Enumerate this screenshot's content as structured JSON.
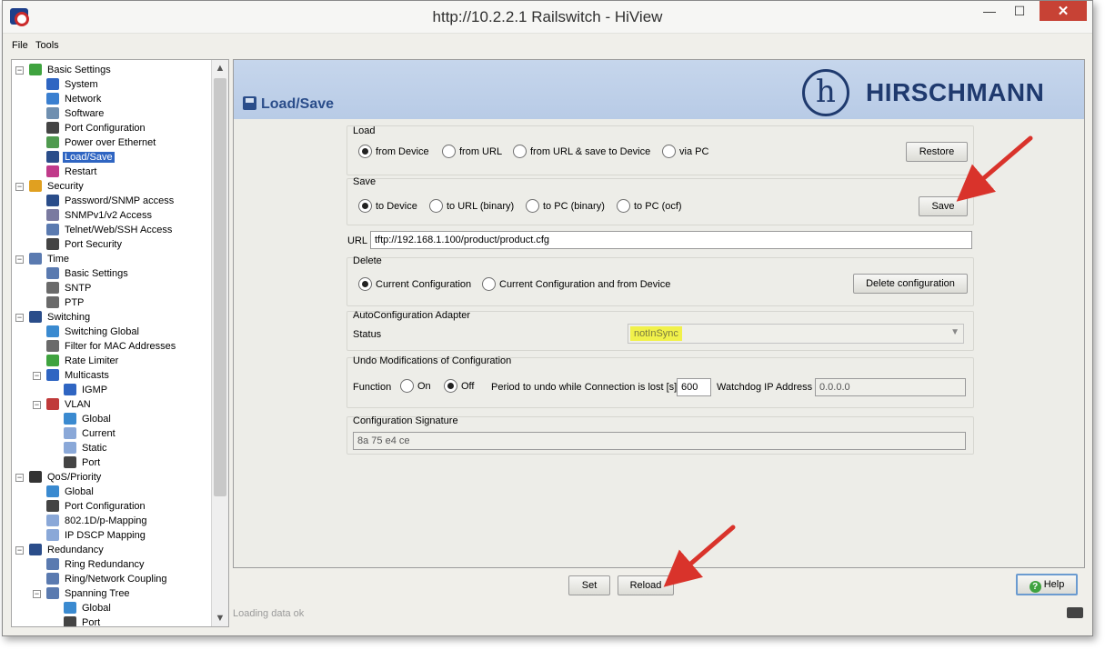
{
  "window": {
    "title": "http://10.2.2.1 Railswitch - HiView",
    "min_label": "—",
    "max_label": "☐",
    "close_label": "✕"
  },
  "menu": {
    "file": "File",
    "tools": "Tools"
  },
  "tree": {
    "items": [
      {
        "label": "Basic Settings",
        "icon": "star-icon",
        "color": "#3fa33f"
      },
      {
        "label": "System",
        "icon": "info-icon",
        "color": "#2f65c2"
      },
      {
        "label": "Network",
        "icon": "network-icon",
        "color": "#3a7fd0"
      },
      {
        "label": "Software",
        "icon": "software-icon",
        "color": "#6f8fb0"
      },
      {
        "label": "Port Configuration",
        "icon": "port-icon",
        "color": "#444444"
      },
      {
        "label": "Power over Ethernet",
        "icon": "poe-icon",
        "color": "#4f9a4f"
      },
      {
        "label": "Load/Save",
        "icon": "floppy-icon",
        "color": "#2a4d8a"
      },
      {
        "label": "Restart",
        "icon": "restart-icon",
        "color": "#c03a8a"
      },
      {
        "label": "Security",
        "icon": "lock-icon",
        "color": "#e0a020"
      },
      {
        "label": "Password/SNMP access",
        "icon": "pin-icon",
        "color": "#2a4d8a"
      },
      {
        "label": "SNMPv1/v2 Access",
        "icon": "snmp-icon",
        "color": "#7a7aa0"
      },
      {
        "label": "Telnet/Web/SSH Access",
        "icon": "telnet-icon",
        "color": "#5a7ab0"
      },
      {
        "label": "Port Security",
        "icon": "port-icon",
        "color": "#444444"
      },
      {
        "label": "Time",
        "icon": "clock-icon",
        "color": "#5a7ab0"
      },
      {
        "label": "Basic Settings",
        "icon": "clock-icon",
        "color": "#5a7ab0"
      },
      {
        "label": "SNTP",
        "icon": "sntp-icon",
        "color": "#6a6a6a"
      },
      {
        "label": "PTP",
        "icon": "ptp-icon",
        "color": "#6a6a6a"
      },
      {
        "label": "Switching",
        "icon": "switching-icon",
        "color": "#2a4d8a"
      },
      {
        "label": "Switching Global",
        "icon": "global-icon",
        "color": "#3a8ad0"
      },
      {
        "label": "Filter for MAC Addresses",
        "icon": "filter-icon",
        "color": "#6a6a6a"
      },
      {
        "label": "Rate Limiter",
        "icon": "rate-icon",
        "color": "#3fa33f"
      },
      {
        "label": "Multicasts",
        "icon": "multicast-icon",
        "color": "#2f65c2"
      },
      {
        "label": "IGMP",
        "icon": "multicast-icon",
        "color": "#2f65c2"
      },
      {
        "label": "VLAN",
        "icon": "vlan-icon",
        "color": "#c03a3a"
      },
      {
        "label": "Global",
        "icon": "global-icon",
        "color": "#3a8ad0"
      },
      {
        "label": "Current",
        "icon": "table-icon",
        "color": "#8aa8d8"
      },
      {
        "label": "Static",
        "icon": "table-icon",
        "color": "#8aa8d8"
      },
      {
        "label": "Port",
        "icon": "port-icon",
        "color": "#444444"
      },
      {
        "label": "QoS/Priority",
        "icon": "traffic-light-icon",
        "color": "#333333"
      },
      {
        "label": "Global",
        "icon": "global-icon",
        "color": "#3a8ad0"
      },
      {
        "label": "Port Configuration",
        "icon": "port-icon",
        "color": "#444444"
      },
      {
        "label": "802.1D/p-Mapping",
        "icon": "table-icon",
        "color": "#8aa8d8"
      },
      {
        "label": "IP DSCP Mapping",
        "icon": "table-icon",
        "color": "#8aa8d8"
      },
      {
        "label": "Redundancy",
        "icon": "redundancy-icon",
        "color": "#2a4d8a"
      },
      {
        "label": "Ring Redundancy",
        "icon": "ring-icon",
        "color": "#5a7ab0"
      },
      {
        "label": "Ring/Network Coupling",
        "icon": "coupling-icon",
        "color": "#5a7ab0"
      },
      {
        "label": "Spanning Tree",
        "icon": "tree-icon",
        "color": "#5a7ab0"
      },
      {
        "label": "Global",
        "icon": "global-icon",
        "color": "#3a8ad0"
      },
      {
        "label": "Port",
        "icon": "port-icon",
        "color": "#444444"
      }
    ]
  },
  "page": {
    "title": "Load/Save",
    "brand": "HIRSCHMANN",
    "brand_mark": "h",
    "load": {
      "title": "Load",
      "options": [
        "from Device",
        "from URL",
        "from URL & save to Device",
        "via PC"
      ],
      "selected": 0,
      "button": "Restore"
    },
    "save": {
      "title": "Save",
      "options": [
        "to Device",
        "to URL (binary)",
        "to PC (binary)",
        "to PC (ocf)"
      ],
      "selected": 0,
      "button": "Save"
    },
    "url": {
      "label": "URL",
      "value": "tftp://192.168.1.100/product/product.cfg"
    },
    "delete": {
      "title": "Delete",
      "options": [
        "Current Configuration",
        "Current Configuration and from Device"
      ],
      "selected": 0,
      "button": "Delete configuration"
    },
    "aca": {
      "title": "AutoConfiguration Adapter",
      "status_label": "Status",
      "status_value": "notInSync"
    },
    "undo": {
      "title": "Undo Modifications of Configuration",
      "function_label": "Function",
      "on": "On",
      "off": "Off",
      "period_label": "Period to undo while Connection is lost [s]",
      "period_value": "600",
      "watchdog_label": "Watchdog IP Address",
      "watchdog_value": "0.0.0.0"
    },
    "signature": {
      "title": "Configuration Signature",
      "value": "8a 75 e4 ce"
    }
  },
  "footer": {
    "set": "Set",
    "reload": "Reload",
    "help": "Help",
    "status": "Loading data ok"
  },
  "colors": {
    "accent": "#2f65c2",
    "brand": "#1f3a6e",
    "arrow": "#d9332b",
    "highlight": "#f1f14a"
  }
}
